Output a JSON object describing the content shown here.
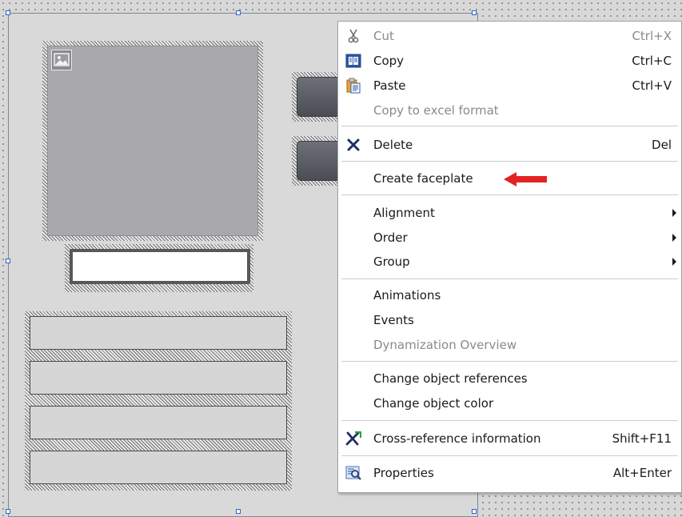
{
  "menu": {
    "items": [
      {
        "label": "Cut",
        "shortcut": "Ctrl+X",
        "icon": "scissors-icon",
        "disabled": true
      },
      {
        "label": "Copy",
        "shortcut": "Ctrl+C",
        "icon": "copy-icon"
      },
      {
        "label": "Paste",
        "shortcut": "Ctrl+V",
        "icon": "paste-icon"
      },
      {
        "label": "Copy to excel format",
        "shortcut": "",
        "disabled": true
      },
      {
        "label": "Delete",
        "shortcut": "Del",
        "icon": "delete-x-icon"
      },
      {
        "label": "Create faceplate",
        "shortcut": "",
        "highlighted_by": "red-arrow-icon"
      },
      {
        "label": "Alignment",
        "submenu": true
      },
      {
        "label": "Order",
        "submenu": true
      },
      {
        "label": "Group",
        "submenu": true
      },
      {
        "label": "Animations",
        "shortcut": ""
      },
      {
        "label": "Events",
        "shortcut": ""
      },
      {
        "label": "Dynamization Overview",
        "shortcut": "",
        "disabled": true
      },
      {
        "label": "Change object references",
        "shortcut": ""
      },
      {
        "label": "Change object color",
        "shortcut": ""
      },
      {
        "label": "Cross-reference information",
        "shortcut": "Shift+F11",
        "icon": "cross-reference-icon"
      },
      {
        "label": "Properties",
        "shortcut": "Alt+Enter",
        "icon": "properties-icon"
      }
    ]
  },
  "colors": {
    "menu_bg": "#ffffff",
    "disabled_text": "#8a8a8a",
    "arrow_red": "#e32222",
    "selection_handle": "#2a64c8",
    "button_object": "#5a5c64"
  },
  "canvas": {
    "objects": [
      "image-placeholder",
      "button-object",
      "button-object",
      "io-field",
      "bar",
      "bar",
      "bar",
      "bar"
    ]
  }
}
